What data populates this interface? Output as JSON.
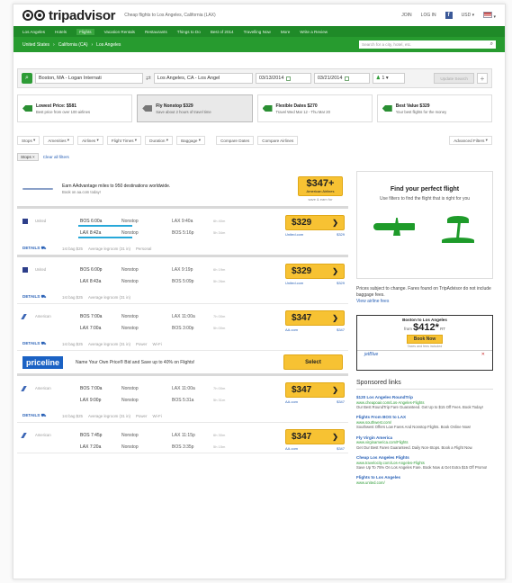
{
  "header": {
    "logo": "tripadvisor",
    "tagline": "Cheap flights to Los Angeles, California (LAX)",
    "join": "JOIN",
    "login": "LOG IN",
    "currency": "USD",
    "nav": [
      "Los Angeles",
      "Hotels",
      "Flights",
      "Vacation Rentals",
      "Restaurants",
      "Things to Do",
      "Best of 2014",
      "Travelling Now",
      "More",
      "Write a Review"
    ],
    "breadcrumb": [
      "United States",
      "California (CA)",
      "Los Angeles"
    ],
    "search_placeholder": "Search for a city, hotel, etc."
  },
  "search": {
    "from": "Boston, MA - Logan Internati",
    "to": "Los Angeles, CA - Los Angel",
    "depart": "03/13/2014",
    "return": "03/21/2014",
    "passengers": "1",
    "update_label": "Update Search",
    "add_label": "+"
  },
  "filter_cards": [
    {
      "title": "Lowest Price: $581",
      "sub": "Best price from over 100 airlines"
    },
    {
      "title": "Fly Nonstop $329",
      "sub": "Save about 2 hours of travel time"
    },
    {
      "title": "Flexible Dates $270",
      "sub": "Travel Wed Mar 12 - Thu Mar 20"
    },
    {
      "title": "Best Value $329",
      "sub": "Your best flights for the money"
    }
  ],
  "dropdowns": [
    "Stops",
    "Amenities",
    "Airlines",
    "Flight Times",
    "Duration",
    "Baggage"
  ],
  "compare_dates": "Compare Dates",
  "compare_airlines": "Compare Airlines",
  "advanced_filters": "Advanced Filters",
  "active_chip": "Stops",
  "clear_all": "Clear all filters",
  "promo": {
    "text": "Earn AAdvantage miles to 950 destinations worldwide.",
    "sub": "Book on aa.com today!",
    "price": "$347+",
    "airline": "American Airlines",
    "via": "save & earn for"
  },
  "flights": [
    {
      "airline": "United",
      "price": "$329",
      "via": "United.com",
      "total": "$329",
      "rows": [
        {
          "dep": "BOS 6:00a",
          "stops": "Nonstop",
          "arr": "LAX 9:40a",
          "dur": "6h 40m"
        },
        {
          "dep": "LAX 8:42a",
          "stops": "Nonstop",
          "arr": "BOS 5:16p",
          "dur": "5h 34m"
        }
      ],
      "amenities": [
        "1st bag $25",
        "Average legroom (31 in)",
        "Personal"
      ]
    },
    {
      "airline": "United",
      "price": "$329",
      "via": "United.com",
      "total": "$329",
      "rows": [
        {
          "dep": "BOS 6:00p",
          "stops": "Nonstop",
          "arr": "LAX 9:19p",
          "dur": "6h 19m"
        },
        {
          "dep": "LAX 8:43a",
          "stops": "Nonstop",
          "arr": "BOS 5:09p",
          "dur": "5h 26m"
        }
      ],
      "amenities": [
        "1st bag $25",
        "Average legroom (31 in)"
      ]
    },
    {
      "airline": "American",
      "price": "$347",
      "via": "AA.com",
      "total": "$347",
      "rows": [
        {
          "dep": "BOS 7:00a",
          "stops": "Nonstop",
          "arr": "LAX 11:00a",
          "dur": "7h 00m"
        },
        {
          "dep": "LAX 7:00a",
          "stops": "Nonstop",
          "arr": "BOS 3:00p",
          "dur": "5h 00m"
        }
      ],
      "amenities": [
        "1st bag $25",
        "Average legroom (31 in)",
        "Power",
        "Wi-Fi"
      ]
    },
    {
      "airline": "American",
      "price": "$347",
      "via": "AA.com",
      "total": "$347",
      "rows": [
        {
          "dep": "BOS 7:00a",
          "stops": "Nonstop",
          "arr": "LAX 11:00a",
          "dur": "7h 00m"
        },
        {
          "dep": "LAX 9:00p",
          "stops": "Nonstop",
          "arr": "BOS 5:31a",
          "dur": "5h 31m"
        }
      ],
      "amenities": [
        "1st bag $25",
        "Average legroom (31 in)",
        "Power",
        "Wi-Fi"
      ]
    },
    {
      "airline": "American",
      "price": "$347",
      "via": "AA.com",
      "total": "$347",
      "rows": [
        {
          "dep": "BOS 7:45p",
          "stops": "Nonstop",
          "arr": "LAX 11:15p",
          "dur": "6h 30m"
        },
        {
          "dep": "LAX 7:20a",
          "stops": "Nonstop",
          "arr": "BOS 3:35p",
          "dur": "5h 15m"
        }
      ],
      "amenities": []
    }
  ],
  "details_label": "DETAILS",
  "priceline": {
    "logo": "priceline",
    "text": "Name Your Own Price® Bid and Save up to 40% on Flights!",
    "button": "Select"
  },
  "side": {
    "pf_title": "Find your perfect flight",
    "pf_sub": "Use filters to find the flight that is right for you",
    "note": "Prices subject to change. Fares found on TripAdvisor do not include baggage fees.",
    "note_link": "View airline fees",
    "deal_header": "Boston to Los Angeles",
    "deal_from": "from",
    "deal_price": "$412*",
    "deal_rt": "RT",
    "deal_button": "Book Now",
    "deal_taxes": "Taxes and fees included",
    "deal_airline": "jetBlue",
    "sponsored_title": "Sponsored links",
    "ads": [
      {
        "t": "$120 Los Angeles RoundTrip",
        "u": "www.cheapoair.com/Los-Angeles-Flights",
        "d": "Our Best RoundTrip Fare Guaranteed. Get Up to $15 Off Fees. Book Today!"
      },
      {
        "t": "Flights From BOS to LAX",
        "u": "www.southwest.com/",
        "d": "Southwest Offers Low Fares And Nonstop Flights. Book Online Now!"
      },
      {
        "t": "Fly Virgin America",
        "u": "www.virginamerica.com/Flights",
        "d": "Get Our Best Fares Guaranteed. Daily Non-Stops. Book a Flight Now."
      },
      {
        "t": "Cheap Los Angeles Flights",
        "u": "www.travelocity.com/Los-Angeles-Flights",
        "d": "Save Up To 75% On Los Angeles Fare. Book Now & Get Extra $15 Off Promo!"
      },
      {
        "t": "Flights to Los Angeles",
        "u": "www.united.com/",
        "d": ""
      }
    ]
  }
}
